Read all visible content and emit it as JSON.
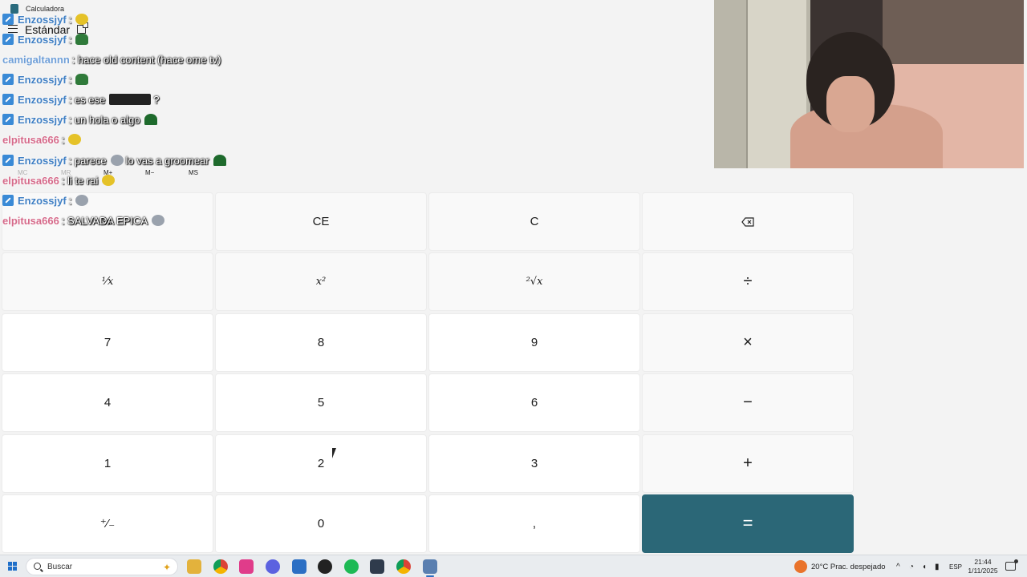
{
  "window": {
    "title": "Calculadora",
    "mode": "Estándar"
  },
  "memory": {
    "buttons": [
      {
        "label": "MC",
        "enabled": false
      },
      {
        "label": "MR",
        "enabled": false
      },
      {
        "label": "M+",
        "enabled": true
      },
      {
        "label": "M−",
        "enabled": true
      },
      {
        "label": "MS",
        "enabled": true
      }
    ]
  },
  "keypad": {
    "percent": "%",
    "ce": "CE",
    "c": "C",
    "backspace_icon": "backspace-icon",
    "reciprocal": "¹⁄x",
    "square": "x²",
    "sqrt": "²√x",
    "divide": "÷",
    "seven": "7",
    "eight": "8",
    "nine": "9",
    "multiply": "×",
    "four": "4",
    "five": "5",
    "six": "6",
    "minus": "−",
    "one": "1",
    "two": "2",
    "three": "3",
    "plus": "+",
    "negate": "⁺⁄₋",
    "zero": "0",
    "decimal": ",",
    "equals": "="
  },
  "chat": [
    {
      "user": "Enzossjyf",
      "text": ":",
      "badge": true,
      "emote": "yellow"
    },
    {
      "user": "Enzossjyf",
      "text": ":",
      "badge": true,
      "emote": "green"
    },
    {
      "user": "camigaltannn",
      "text": ": hace old content (hace ome tv)",
      "badge": false,
      "emote": ""
    },
    {
      "user": "Enzossjyf",
      "text": ":",
      "badge": true,
      "emote": "green"
    },
    {
      "user": "Enzossjyf",
      "text": ": es ese",
      "badge": true,
      "emote": "dark",
      "suffix": "?"
    },
    {
      "user": "Enzossjyf",
      "text": ": un hola o algo",
      "badge": true,
      "emote": "hat"
    },
    {
      "user": "elpitusa666",
      "text": ":",
      "badge": false,
      "emote": "yellow"
    },
    {
      "user": "Enzossjyf",
      "text": ": parece",
      "badge": true,
      "emote": "grey",
      "suffix": "lo vas a groomear"
    },
    {
      "user": "elpitusa666",
      "text": ": li te rai",
      "badge": false,
      "emote": "yellow"
    },
    {
      "user": "Enzossjyf",
      "text": ":",
      "badge": true,
      "emote": "grey"
    },
    {
      "user": "elpitusa666",
      "text": ": SALVADA EPICA",
      "badge": false,
      "emote": "grey"
    }
  ],
  "taskbar": {
    "search_placeholder": "Buscar",
    "weather": "20°C  Prac. despejado",
    "language": "ESP",
    "time": "21:44",
    "date": "1/11/2025"
  }
}
